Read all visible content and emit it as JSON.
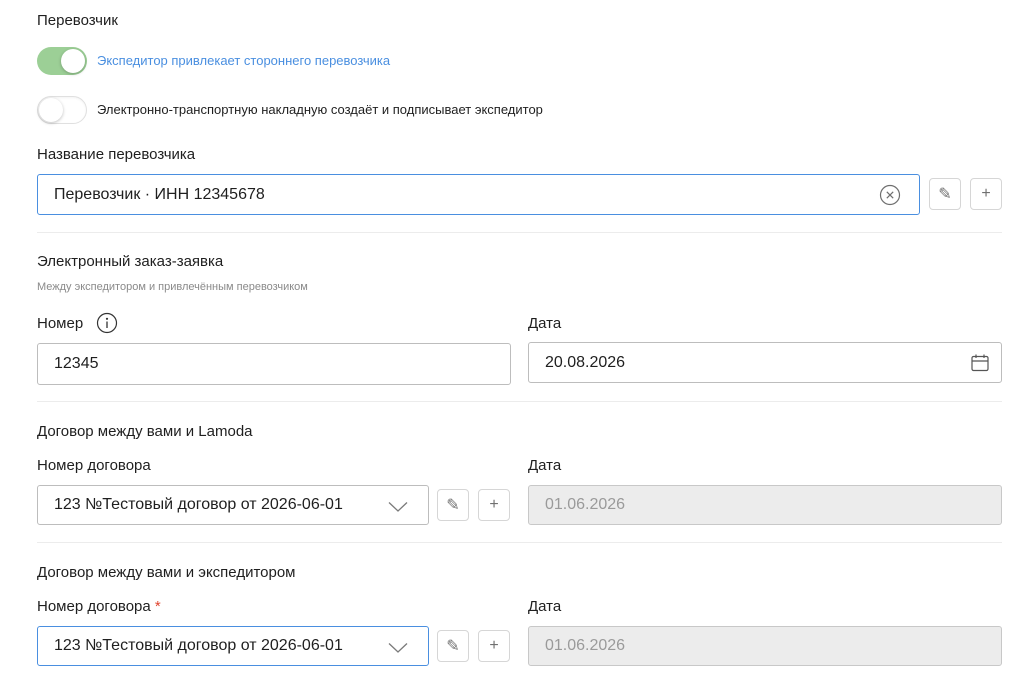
{
  "carrier": {
    "title": "Перевозчик",
    "toggle1_label": "Экспедитор привлекает стороннего перевозчика",
    "toggle2_label": "Электронно-транспортную накладную создаёт и подписывает экспедитор",
    "name_label": "Название перевозчика",
    "name_value": "Перевозчик · ИНН 12345678"
  },
  "order": {
    "title": "Электронный заказ-заявка",
    "hint": "Между экспедитором и привлечённым перевозчиком",
    "number_label": "Номер",
    "number_value": "12345",
    "date_label": "Дата",
    "date_value": "20.08.2026"
  },
  "lamoda_contract": {
    "title": "Договор между вами и Lamoda",
    "number_label": "Номер договора",
    "number_value": "123 №Тестовый договор от 2026-06-01",
    "date_label": "Дата",
    "date_value": "01.06.2026"
  },
  "forwarder_contract": {
    "title": "Договор между вами и экспедитором",
    "number_label": "Номер договора",
    "required_mark": "*",
    "number_value": "123 №Тестовый договор от 2026-06-01",
    "date_label": "Дата",
    "date_value": "01.06.2026"
  },
  "buttons": {
    "edit": "✎",
    "add": "+"
  },
  "colors": {
    "accent": "#4a8fe0",
    "toggle_on": "#9ccf96",
    "required": "#e0442f",
    "link_text": "#4a8fe0"
  }
}
